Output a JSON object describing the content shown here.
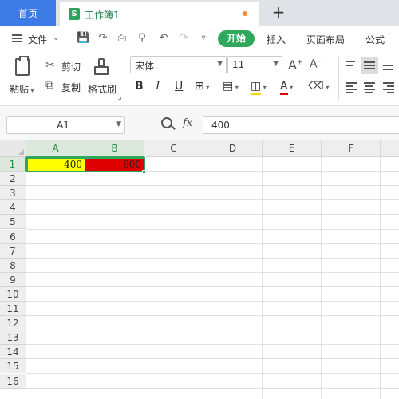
{
  "tabs": {
    "home_label": "首页",
    "doc_icon_letter": "S",
    "doc_name": "工作簿1",
    "new_tab_symbol": "+"
  },
  "menu": {
    "file_label": "文件",
    "tabs": [
      "开始",
      "插入",
      "页面布局",
      "公式"
    ],
    "active_tab": "开始"
  },
  "ribbon": {
    "paste_label": "粘贴",
    "cut_label": "剪切",
    "copy_label": "复制",
    "format_painter_label": "格式刷",
    "font_name": "宋体",
    "font_size": "11",
    "bold": "B",
    "italic": "I",
    "underline": "U",
    "increase_font": "A",
    "decrease_font": "A"
  },
  "formula_bar": {
    "name_box": "A1",
    "fx_label": "fx",
    "formula_value": "400"
  },
  "sheet": {
    "columns": [
      "A",
      "B",
      "C",
      "D",
      "E",
      "F"
    ],
    "rows": [
      "1",
      "2",
      "3",
      "4",
      "5",
      "6",
      "7",
      "8",
      "9",
      "10",
      "11",
      "12",
      "13",
      "14",
      "15",
      "16"
    ],
    "cells": {
      "A1": {
        "value": "400",
        "bg": "#ffff00"
      },
      "B1": {
        "value": "600",
        "bg": "#e00000"
      }
    }
  },
  "colors": {
    "accent_green": "#2fa85b",
    "home_tab_blue": "#3d7be6"
  }
}
